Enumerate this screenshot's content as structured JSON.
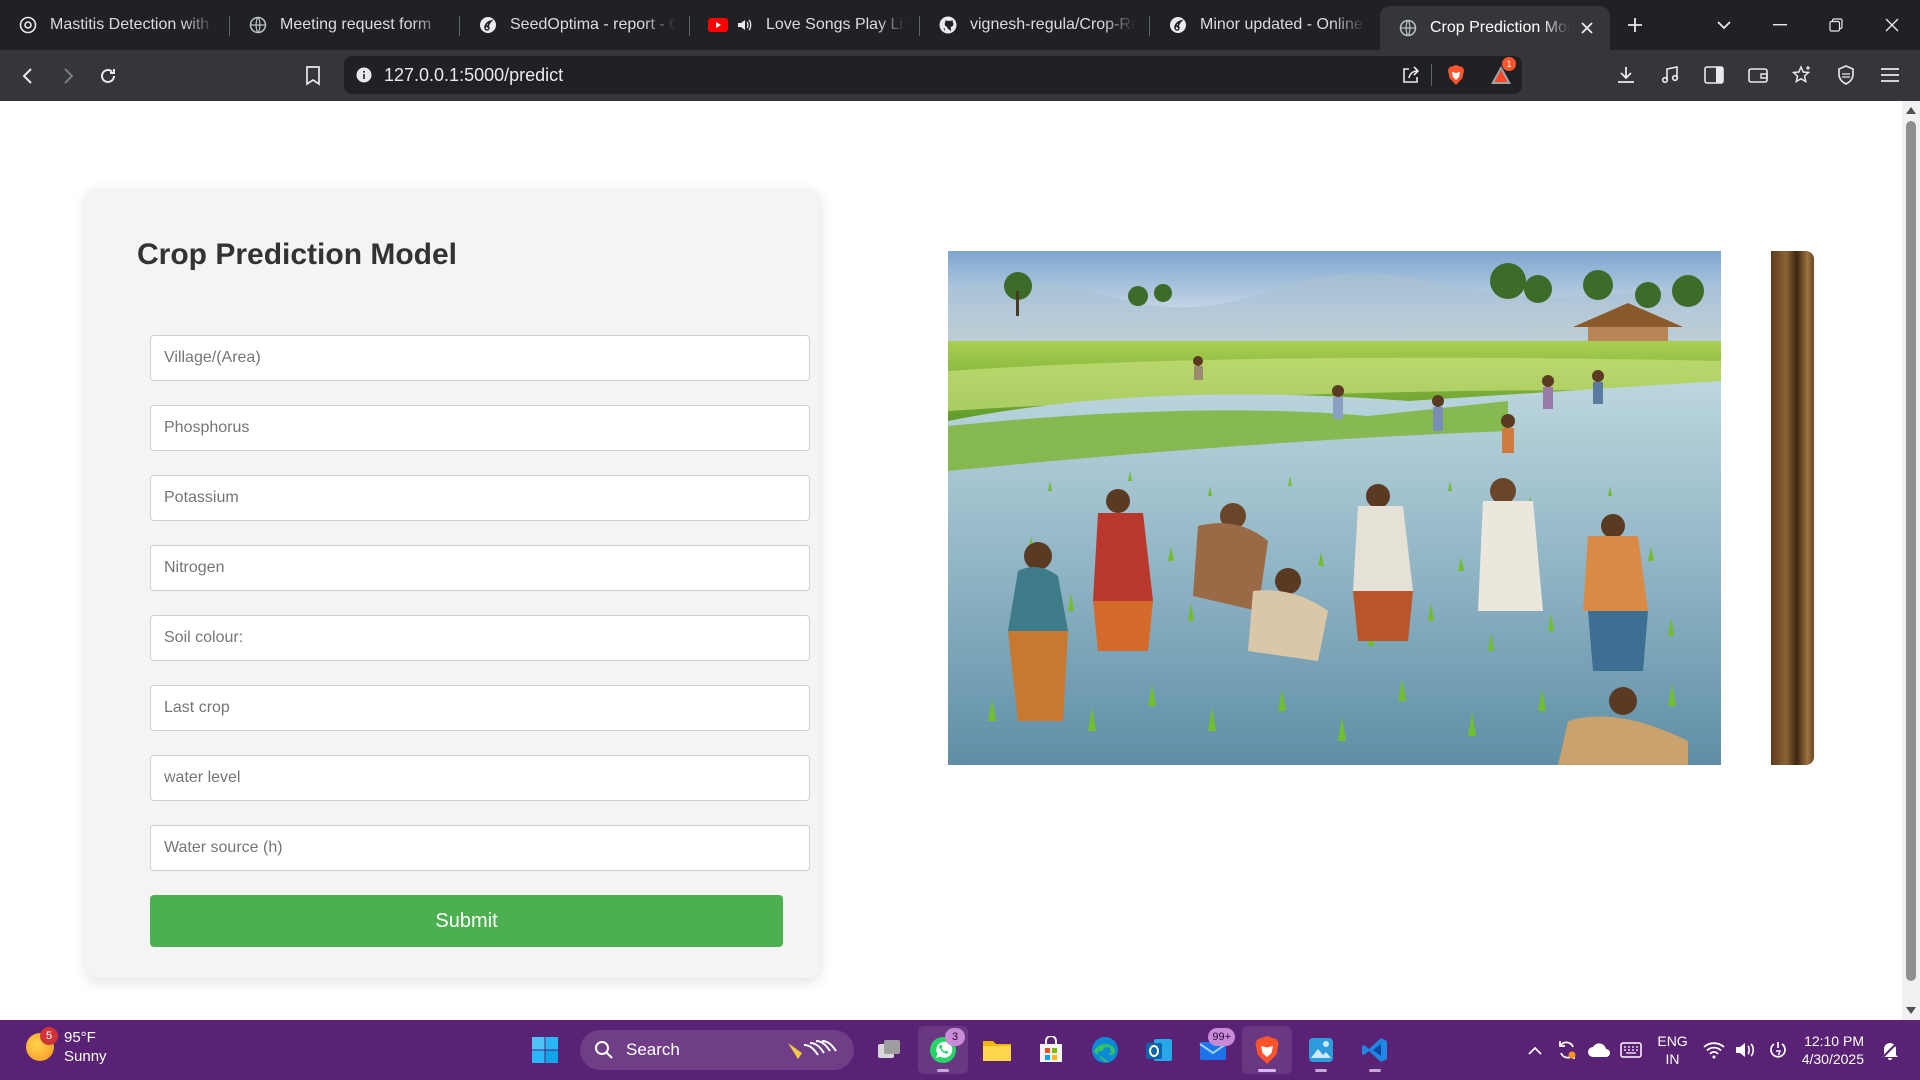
{
  "browser": {
    "tabs": [
      {
        "title": "Mastitis Detection with M",
        "icon": "openai-icon"
      },
      {
        "title": "Meeting request form",
        "icon": "globe-icon"
      },
      {
        "title": "SeedOptima - report - On",
        "icon": "overleaf-icon"
      },
      {
        "title": "Love Songs Play List S",
        "icon": "youtube-icon"
      },
      {
        "title": "vignesh-regula/Crop-Rec",
        "icon": "github-icon"
      },
      {
        "title": "Minor updated - Online L",
        "icon": "overleaf-icon"
      },
      {
        "title": "Crop Prediction Mod",
        "icon": "globe-icon",
        "active": true
      }
    ],
    "url": "127.0.0.1:5000/predict",
    "brave_alert_count": "1"
  },
  "form": {
    "title": "Crop Prediction Model",
    "fields": [
      {
        "placeholder": "Village/(Area)",
        "value": ""
      },
      {
        "placeholder": "Phosphorus",
        "value": ""
      },
      {
        "placeholder": "Potassium",
        "value": ""
      },
      {
        "placeholder": "Nitrogen",
        "value": ""
      },
      {
        "placeholder": "Soil colour:",
        "value": ""
      },
      {
        "placeholder": "Last crop",
        "value": ""
      },
      {
        "placeholder": "water level",
        "value": ""
      },
      {
        "placeholder": "Water source (h)",
        "value": ""
      }
    ],
    "submit_label": "Submit"
  },
  "colors": {
    "submit_bg": "#4caf50",
    "taskbar_bg": "#5a2274",
    "browser_bg": "#202124"
  },
  "taskbar": {
    "weather": {
      "temp": "95°F",
      "condition": "Sunny",
      "badge": "5"
    },
    "search_label": "Search",
    "whatsapp_badge": "3",
    "outlook_badge": "99+",
    "language": {
      "line1": "ENG",
      "line2": "IN"
    },
    "time": "12:10 PM",
    "date": "4/30/2025"
  }
}
